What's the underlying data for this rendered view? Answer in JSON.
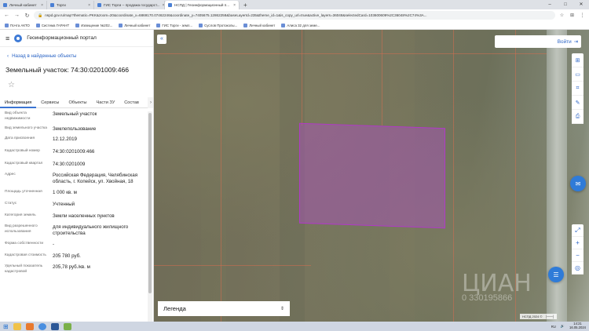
{
  "browser": {
    "tabs": [
      {
        "label": "Личный кабинет",
        "active": false
      },
      {
        "label": "Торги",
        "active": false
      },
      {
        "label": "ГИС Торги -- продажа государст...",
        "active": false
      },
      {
        "label": "НСПД | Геоинформационный п...",
        "active": true
      }
    ],
    "new_tab": "+",
    "url": "nspd.gov.ru/map?thematic=PKK&zoom=20&coordinate_x=6869170.07462246&coordinate_y=7405675.12862258&baseLayerId=235&theme_id=1&is_copy_url=true&active_layers=36048&selectedCard=103600609%2C36048%2C74%3A...",
    "bookmarks": [
      "Почта АКТО",
      "Система ГАРАНТ",
      "Извещение №202...",
      "Личный кабинет",
      "ГИС Торги - земл...",
      "Суслов Протоколы...",
      "Личный кабинет",
      "Алиса 32 для земе..."
    ]
  },
  "app": {
    "portal_title": "Геоинформационный портал",
    "back_link": "Назад в найденные объекты",
    "parcel_title": "Земельный участок: 74:30:0201009:466",
    "tabs": [
      "Информация",
      "Сервисы",
      "Объекты",
      "Части ЗУ",
      "Состав"
    ],
    "properties": [
      {
        "key": "Вид объекта недвижимости",
        "value": "Земельный участок"
      },
      {
        "key": "Вид земельного участка",
        "value": "Землепользование"
      },
      {
        "key": "Дата присвоения",
        "value": "12.12.2019"
      },
      {
        "key": "Кадастровый номер",
        "value": "74:30:0201009:466"
      },
      {
        "key": "Кадастровый квартал",
        "value": "74:30:0201009"
      },
      {
        "key": "Адрес",
        "value": "Российская Федерация, Челябинская область, г. Копейск, ул. Хвойная, 18"
      },
      {
        "key": "Площадь уточненная",
        "value": "1 000 кв. м"
      },
      {
        "key": "Статус",
        "value": "Учтенный"
      },
      {
        "key": "Категория земель",
        "value": "Земли населенных пунктов"
      },
      {
        "key": "Вид разрешенного использования",
        "value": "для индивидуального жилищного строительства"
      },
      {
        "key": "Форма собственности",
        "value": "-"
      },
      {
        "key": "Кадастровая стоимость",
        "value": "205 780 руб."
      },
      {
        "key": "Удельный показатель кадастровой",
        "value": "205,78 руб./кв. м"
      }
    ]
  },
  "map": {
    "login_label": "Войти",
    "legend_label": "Легенда",
    "watermark": "ЦИАН",
    "watermark_id": "0 330195866",
    "scale_label": "НСПД 2024 ©"
  },
  "taskbar": {
    "time": "14:21",
    "date": "16.05.2024"
  },
  "colors": {
    "accent": "#2f7bd8",
    "parcel_fill": "#b04cc8",
    "parcel_border": "#b03ac6"
  }
}
